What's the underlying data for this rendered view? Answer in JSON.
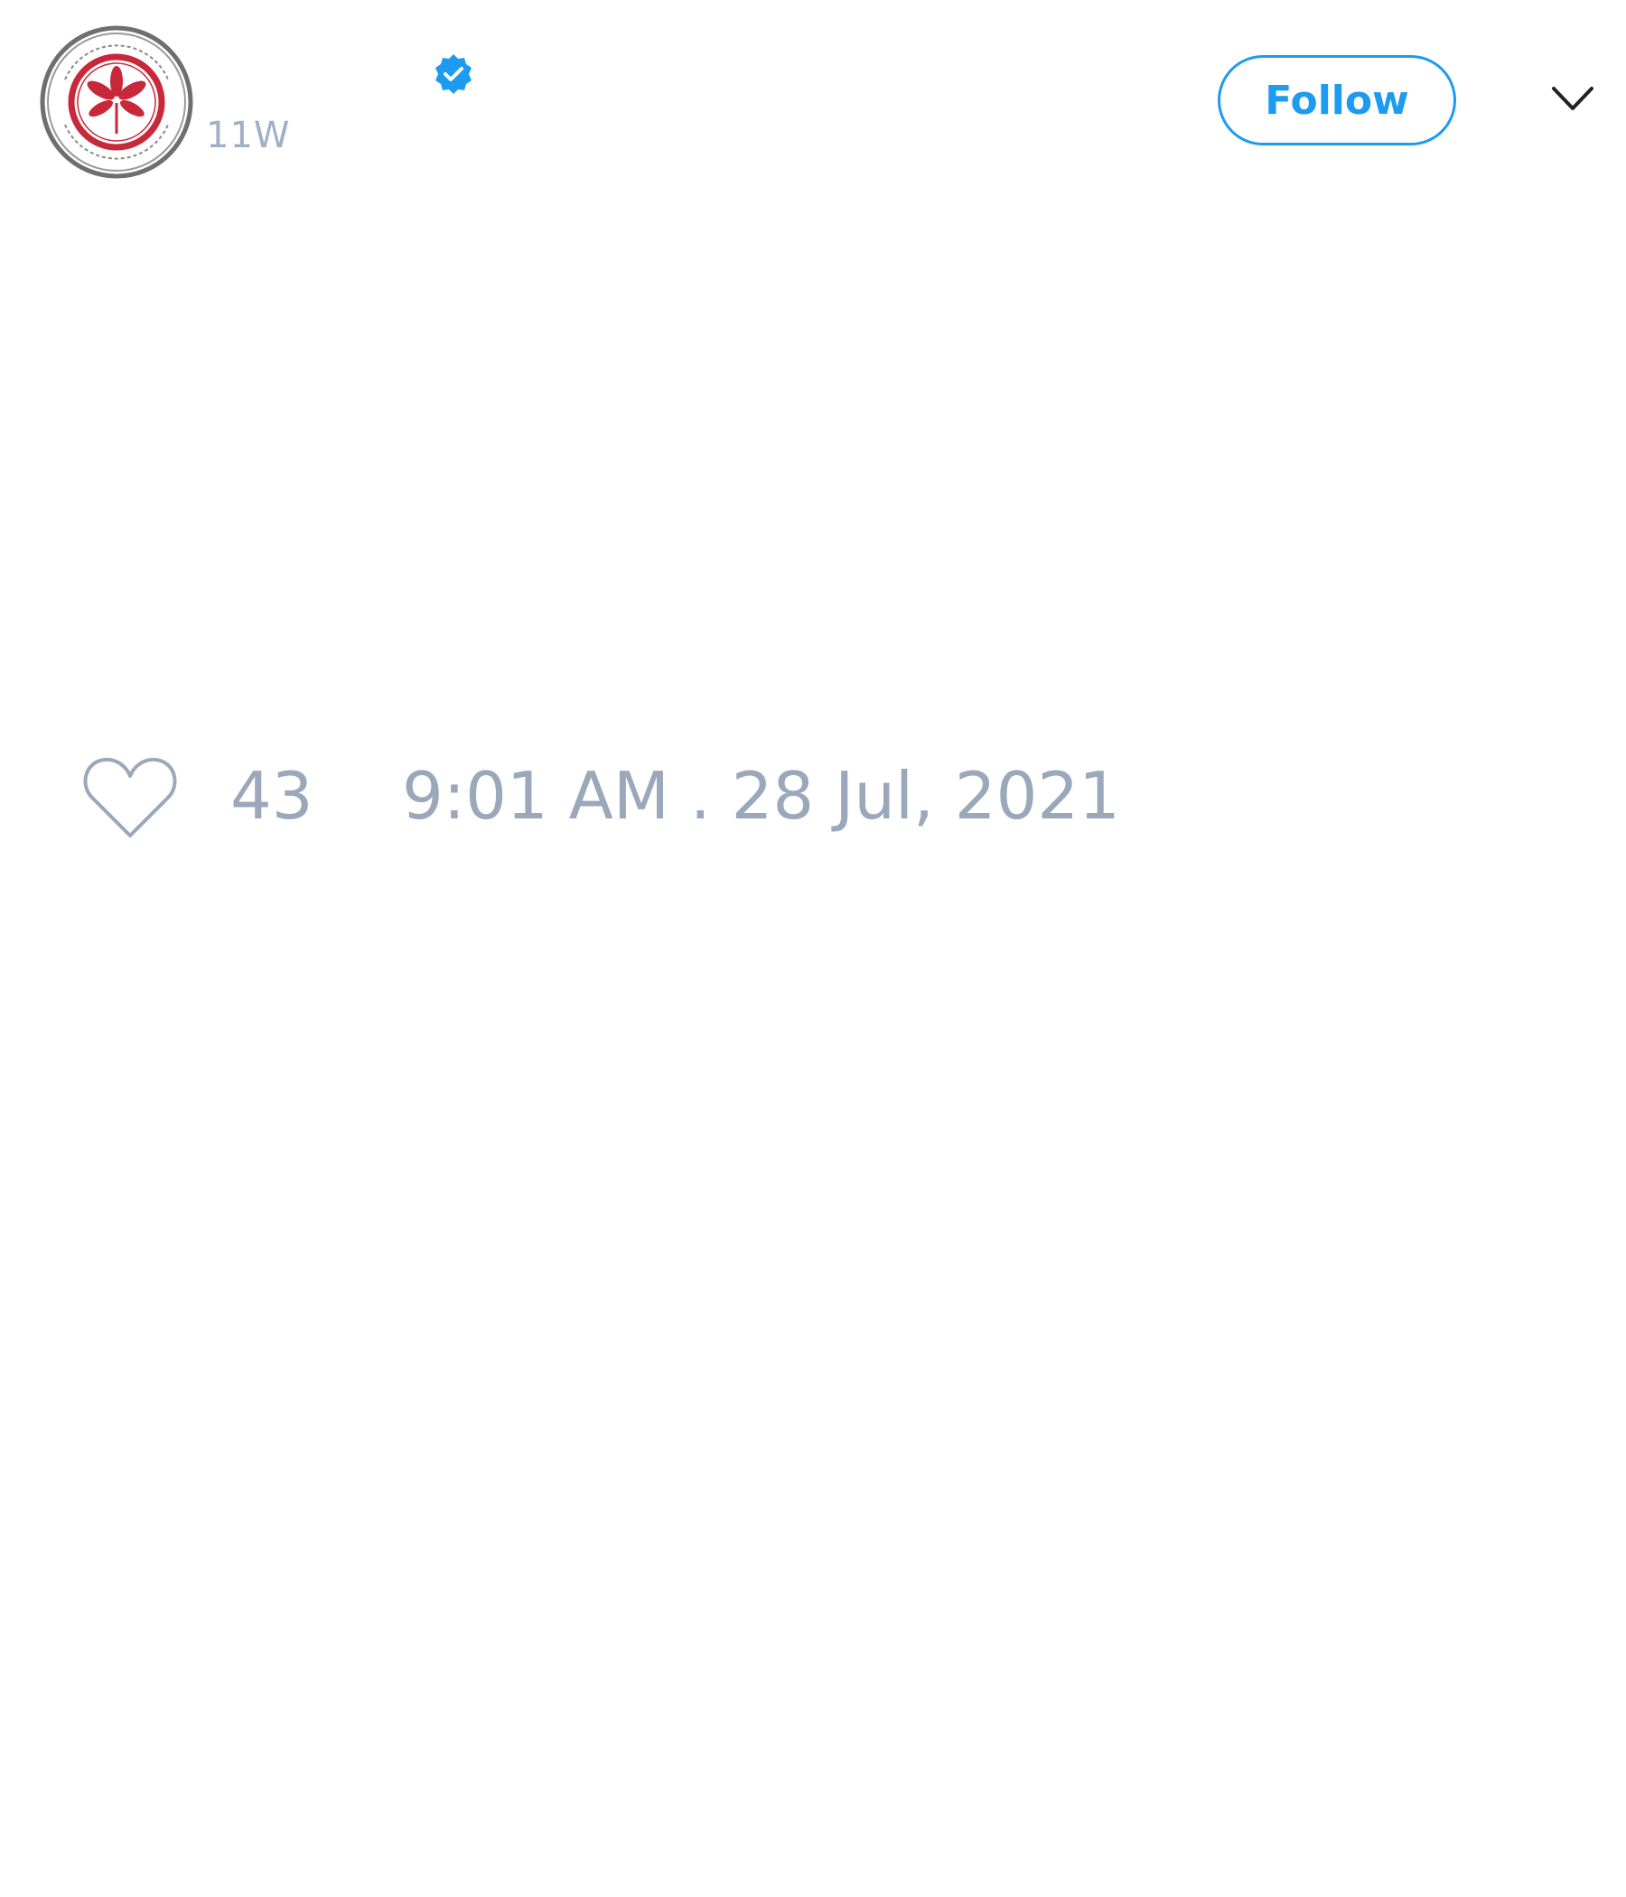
{
  "tweet": {
    "author": {
      "handle": "11W",
      "avatar_icon": "eleven-warriors-seal-icon",
      "avatar_logo_text": "ELEVEN WARRIORS · ACCURACY · EXCELLENCE",
      "verified": true,
      "verified_icon": "verified-badge-icon"
    },
    "follow_label": "Follow",
    "menu_icon": "chevron-down-icon",
    "like_icon": "heart-icon",
    "like_count": "43",
    "timestamp": "9:01 AM . 28 Jul, 2021"
  },
  "colors": {
    "accent": "#1d9bf0",
    "muted_text": "#9aa8ba",
    "seal_red": "#c8283a",
    "seal_gray": "#7a7a7a"
  }
}
